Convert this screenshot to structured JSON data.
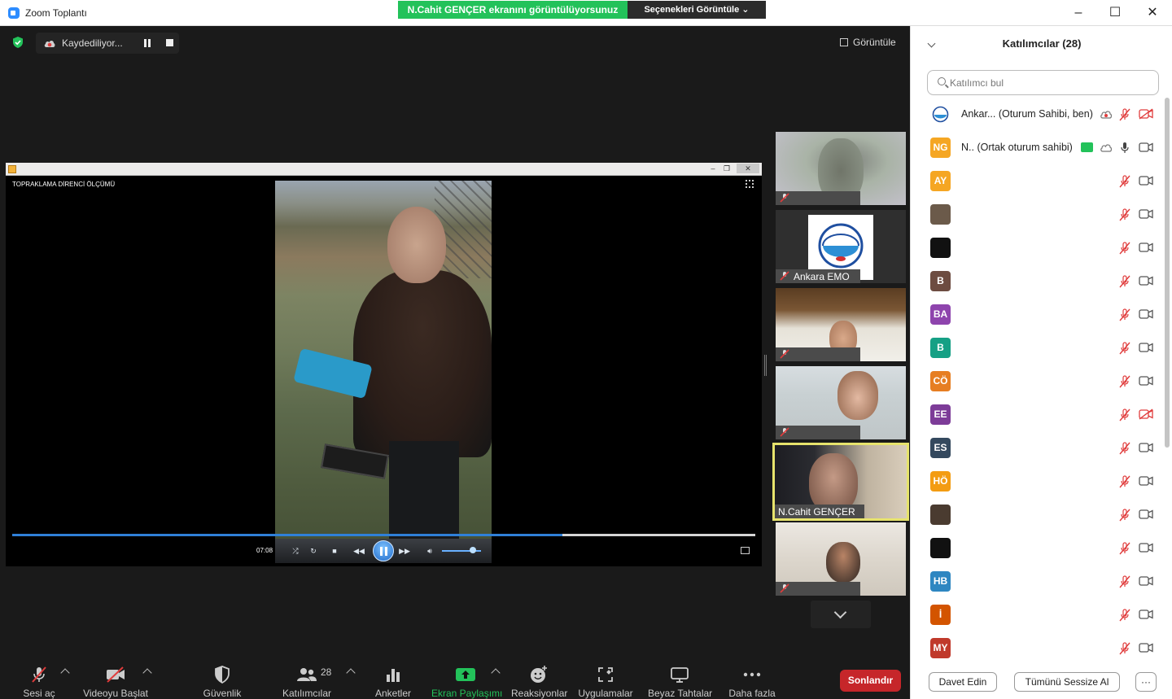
{
  "window": {
    "title": "Zoom Toplantı",
    "share_banner": "N.Cahit GENÇER ekranını görüntülüyorsunuz",
    "view_options": "Seçenekleri Görüntüle"
  },
  "stage": {
    "recording_label": "Kaydediliyor...",
    "view_label": "Görüntüle"
  },
  "media": {
    "caption": "TOPRAKLAMA DİRENCİ ÖLÇÜMÜ",
    "time": "07:08",
    "progress": 0.74,
    "volume": 0.8
  },
  "thumbnails": [
    {
      "name": "",
      "active": false
    },
    {
      "name": "Ankara EMO",
      "active": false
    },
    {
      "name": "",
      "active": false
    },
    {
      "name": "",
      "active": false
    },
    {
      "name": "N.Cahit GENÇER",
      "active": true
    },
    {
      "name": "",
      "active": false
    }
  ],
  "toolbar": {
    "unmute": "Sesi aç",
    "start_video": "Videoyu Başlat",
    "security": "Güvenlik",
    "participants": "Katılımcılar",
    "participants_count": "28",
    "polls": "Anketler",
    "share_screen": "Ekran Paylaşımı",
    "reactions": "Reaksiyonlar",
    "apps": "Uygulamalar",
    "whiteboards": "Beyaz Tahtalar",
    "more": "Daha fazla",
    "end": "Sonlandır"
  },
  "panel": {
    "title": "Katılımcılar (28)",
    "search_placeholder": "Katılımcı bul",
    "participants": [
      {
        "initials": "",
        "color": "#ffffff",
        "name": "Ankar... (Oturum Sahibi, ben)",
        "cam_off": true
      },
      {
        "initials": "NG",
        "color": "#f5a623",
        "name": "N.. (Ortak oturum sahibi)",
        "cam_off": false
      },
      {
        "initials": "AY",
        "color": "#f5a623",
        "name": "",
        "cam_off": false
      },
      {
        "initials": "",
        "color": "#6b5a4a",
        "name": "",
        "cam_off": false
      },
      {
        "initials": "",
        "color": "#111111",
        "name": "",
        "cam_off": false
      },
      {
        "initials": "B",
        "color": "#6d4c41",
        "name": "",
        "cam_off": false
      },
      {
        "initials": "BA",
        "color": "#8e44ad",
        "name": "",
        "cam_off": false
      },
      {
        "initials": "B",
        "color": "#16a085",
        "name": "",
        "cam_off": false
      },
      {
        "initials": "CÖ",
        "color": "#e67e22",
        "name": "",
        "cam_off": false
      },
      {
        "initials": "EE",
        "color": "#7d3c98",
        "name": "",
        "cam_off": true
      },
      {
        "initials": "ES",
        "color": "#34495e",
        "name": "",
        "cam_off": false
      },
      {
        "initials": "HÖ",
        "color": "#f39c12",
        "name": "",
        "cam_off": false
      },
      {
        "initials": "",
        "color": "#4a3b30",
        "name": "",
        "cam_off": false
      },
      {
        "initials": "",
        "color": "#111111",
        "name": "",
        "cam_off": false
      },
      {
        "initials": "HB",
        "color": "#2e86c1",
        "name": "",
        "cam_off": false
      },
      {
        "initials": "İ",
        "color": "#d35400",
        "name": "",
        "cam_off": false
      },
      {
        "initials": "MY",
        "color": "#c0392b",
        "name": "",
        "cam_off": false
      }
    ],
    "invite": "Davet Edin",
    "mute_all": "Tümünü Sessize Al",
    "more": "···"
  },
  "colors": {
    "share_green": "#23c25a",
    "end_red": "#c6262a",
    "active_speaker": "#e7e36c",
    "muted_red": "#e03c3c"
  }
}
